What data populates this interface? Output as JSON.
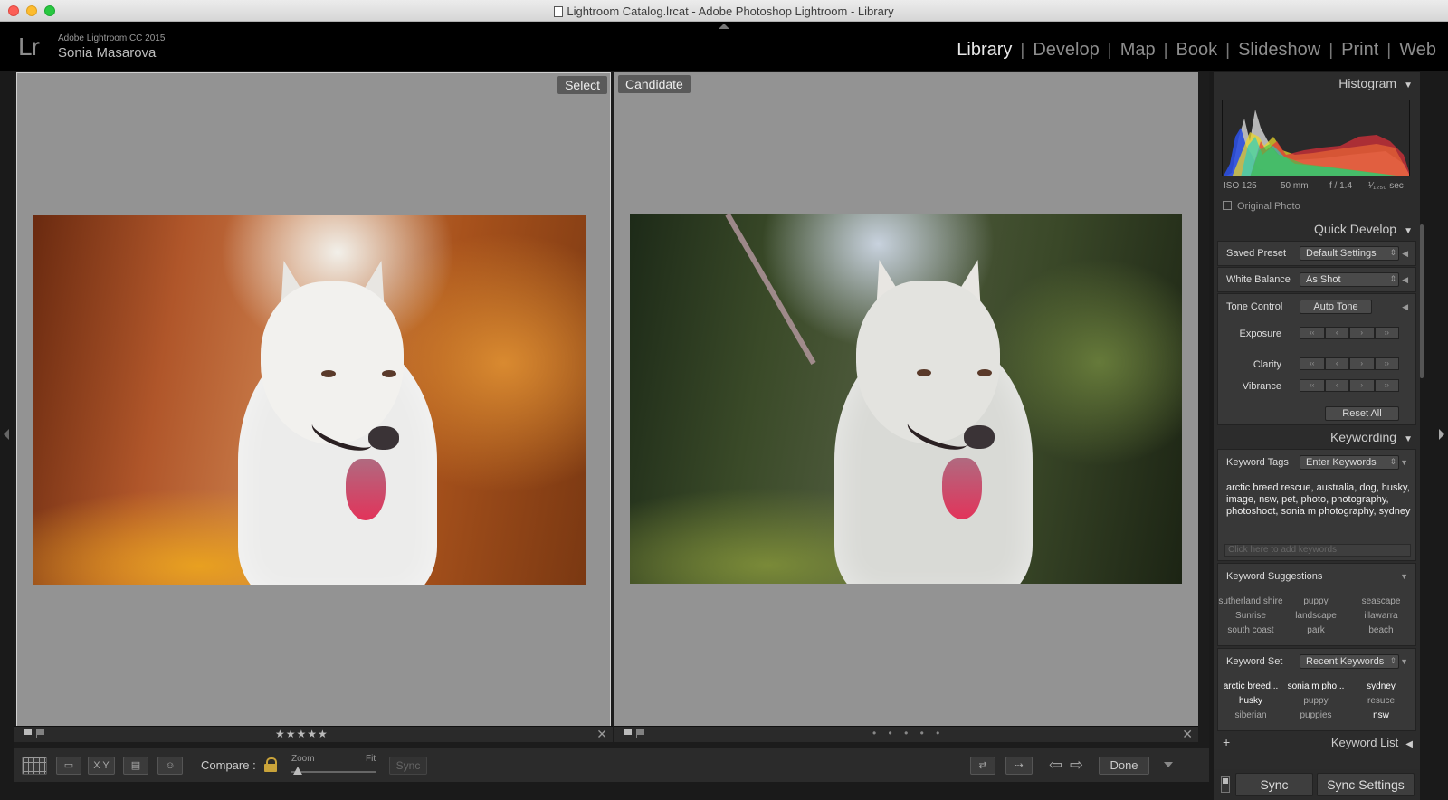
{
  "window": {
    "title": "Lightroom Catalog.lrcat - Adobe Photoshop Lightroom - Library"
  },
  "identity_plate": {
    "logo": "Lr",
    "product": "Adobe Lightroom CC 2015",
    "user": "Sonia Masarova"
  },
  "modules": [
    "Library",
    "Develop",
    "Map",
    "Book",
    "Slideshow",
    "Print",
    "Web"
  ],
  "active_module": "Library",
  "compare": {
    "select_label": "Select",
    "candidate_label": "Candidate",
    "select_rating": "★★★★★",
    "candidate_rating": "• • • • •"
  },
  "toolbar": {
    "compare_label": "Compare :",
    "zoom_label": "Zoom",
    "fit_label": "Fit",
    "sync_label": "Sync",
    "done_label": "Done",
    "xy_label": "X Y"
  },
  "histogram": {
    "title": "Histogram",
    "iso": "ISO 125",
    "focal": "50 mm",
    "aperture": "f / 1.4",
    "shutter": "¹⁄₁₂₅₀ sec",
    "original_photo": "Original Photo"
  },
  "quick_develop": {
    "title": "Quick Develop",
    "saved_preset_label": "Saved Preset",
    "saved_preset_value": "Default Settings",
    "white_balance_label": "White Balance",
    "white_balance_value": "As Shot",
    "tone_control_label": "Tone Control",
    "auto_tone": "Auto Tone",
    "exposure": "Exposure",
    "clarity": "Clarity",
    "vibrance": "Vibrance",
    "reset_all": "Reset All"
  },
  "keywording": {
    "title": "Keywording",
    "keyword_tags_label": "Keyword Tags",
    "keyword_tags_value": "Enter Keywords",
    "keywords": "arctic breed rescue, australia, dog, husky, image, nsw, pet, photo, photography, photoshoot, sonia m photography, sydney",
    "add_placeholder": "Click here to add keywords",
    "suggestions_title": "Keyword Suggestions",
    "suggestions": [
      "sutherland shire",
      "puppy",
      "seascape",
      "Sunrise",
      "landscape",
      "illawarra",
      "south coast",
      "park",
      "beach"
    ],
    "keyword_set_label": "Keyword Set",
    "keyword_set_value": "Recent Keywords",
    "set_keywords": [
      "arctic breed...",
      "sonia m pho...",
      "sydney",
      "husky",
      "puppy",
      "resuce",
      "siberian",
      "puppies",
      "nsw"
    ],
    "set_keywords_on": [
      true,
      true,
      true,
      true,
      false,
      false,
      false,
      false,
      true
    ]
  },
  "keyword_list": {
    "title": "Keyword List"
  },
  "sync": {
    "sync_label": "Sync",
    "sync_settings_label": "Sync Settings"
  }
}
